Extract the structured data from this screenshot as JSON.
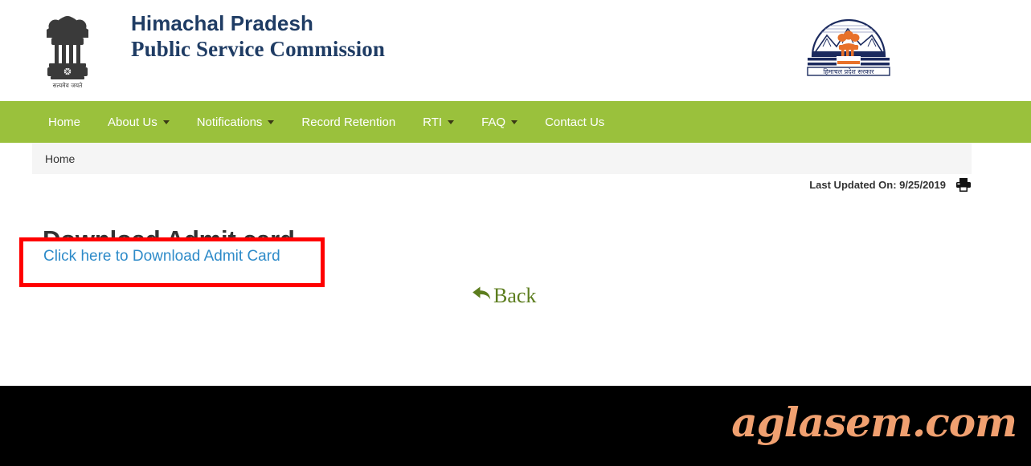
{
  "header": {
    "title_line1": "Himachal Pradesh",
    "title_line2": "Public Service Commission",
    "emblem_caption": "सत्यमेव जयते",
    "state_logo_caption": "हिमाचल प्रदेश सरकार",
    "title_color": "#1f3c64"
  },
  "nav": {
    "background_color": "#9ac13c",
    "items": [
      {
        "label": "Home",
        "has_dropdown": false
      },
      {
        "label": "About Us",
        "has_dropdown": true
      },
      {
        "label": "Notifications",
        "has_dropdown": true
      },
      {
        "label": "Record Retention",
        "has_dropdown": false
      },
      {
        "label": "RTI",
        "has_dropdown": true
      },
      {
        "label": "FAQ",
        "has_dropdown": true
      },
      {
        "label": "Contact Us",
        "has_dropdown": false
      }
    ]
  },
  "breadcrumb": {
    "items": [
      "Home"
    ]
  },
  "meta": {
    "last_updated_label": "Last Updated On: 9/25/2019",
    "print_icon": "printer-icon"
  },
  "main": {
    "heading": "Download Admit card",
    "download_link_label": "Click here to Download Admit Card",
    "download_link_color": "#2e8bc9",
    "highlight_border_color": "#ff0000",
    "back_label": "Back",
    "back_color": "#5c7d1e"
  },
  "footer": {
    "background_color": "#000000",
    "watermark": "aglasem.com",
    "watermark_color": "#f0a070"
  }
}
